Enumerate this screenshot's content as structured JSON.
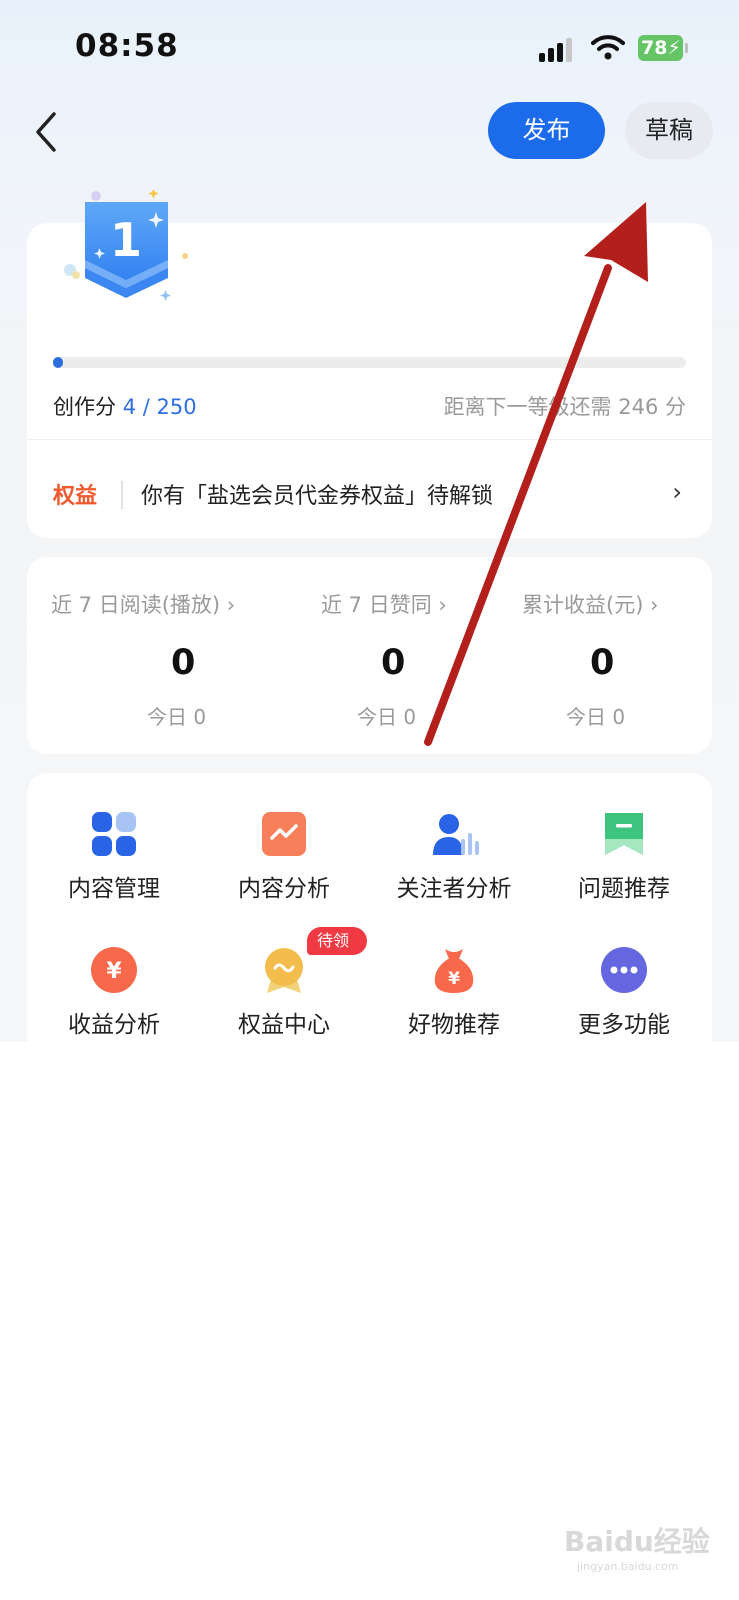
{
  "status_bar": {
    "time": "08:58",
    "battery": "78"
  },
  "header": {
    "back_icon": "chevron-left-icon",
    "publish_label": "发布",
    "draft_label": "草稿"
  },
  "level": {
    "badge_number": "1",
    "progress_fraction": 0.016,
    "score_label": "创作分",
    "score_value": "4 / 250",
    "next_level_text": "距离下一等级还需 246 分"
  },
  "rights": {
    "tag": "权益",
    "text": "你有「盐选会员代金券权益」待解锁",
    "arrow": "›"
  },
  "stats": [
    {
      "label": "近 7 日阅读(播放) ›",
      "value": "0",
      "today": "今日  0"
    },
    {
      "label": "近 7 日赞同 ›",
      "value": "0",
      "today": "今日  0"
    },
    {
      "label": "累计收益(元) ›",
      "value": "0",
      "today": "今日  0"
    }
  ],
  "tools": [
    {
      "label": "内容管理",
      "icon": "grid-icon"
    },
    {
      "label": "内容分析",
      "icon": "trend-chart-icon"
    },
    {
      "label": "关注者分析",
      "icon": "follower-chart-icon"
    },
    {
      "label": "问题推荐",
      "icon": "bookmark-icon"
    },
    {
      "label": "收益分析",
      "icon": "yuan-coin-icon"
    },
    {
      "label": "权益中心",
      "icon": "medal-icon",
      "tag": "待领取"
    },
    {
      "label": "好物推荐",
      "icon": "money-bag-icon"
    },
    {
      "label": "更多功能",
      "icon": "more-dots-icon"
    }
  ],
  "colors": {
    "accent": "#1c6bea",
    "rights": "#f05a2e",
    "annotation_arrow": "#b3201c"
  },
  "watermark": {
    "text": "Baidu经验",
    "sub": "jingyan.baidu.com"
  }
}
